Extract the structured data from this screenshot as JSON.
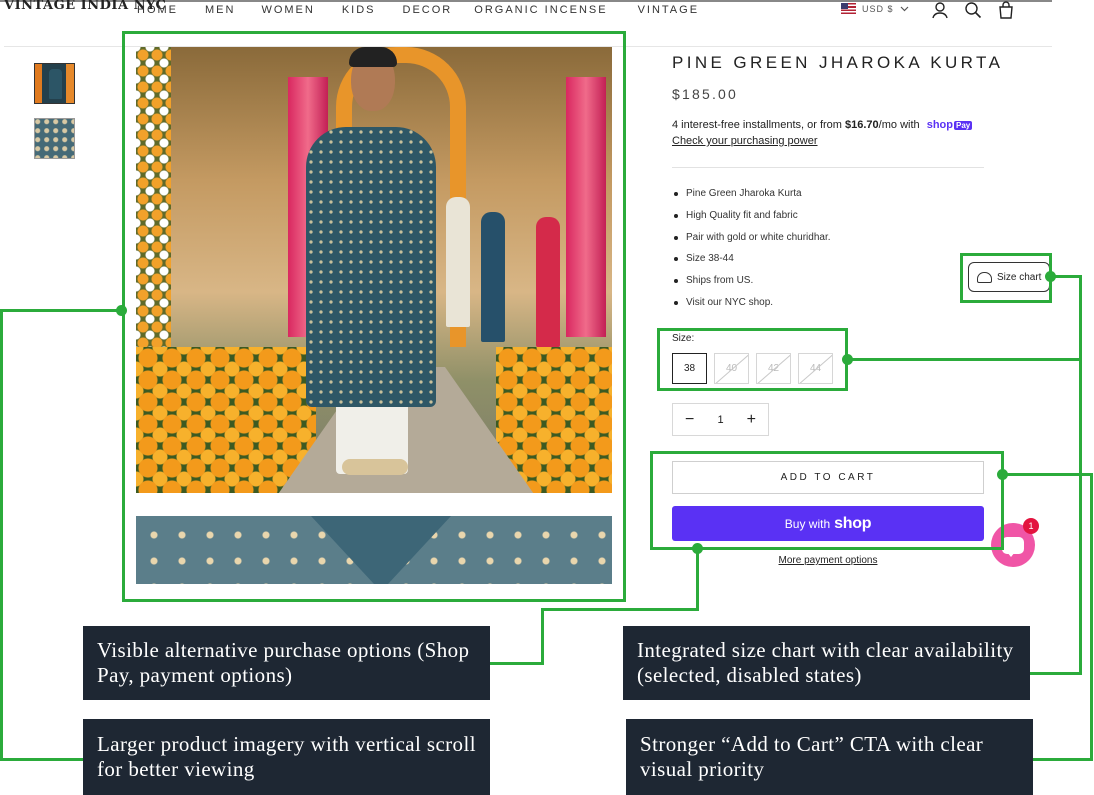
{
  "header": {
    "logo_text": "VINTAGE INDIA NYC",
    "nav": [
      "HOME",
      "MEN",
      "WOMEN",
      "KIDS",
      "DECOR",
      "ORGANIC INCENSE",
      "VINTAGE"
    ],
    "currency": "USD $"
  },
  "product": {
    "title": "PINE GREEN JHAROKA KURTA",
    "price": "$185.00",
    "installments_text": "4 interest-free installments, or from ",
    "installments_amount": "$16.70",
    "installments_suffix": "/mo with",
    "shop_word": "shop",
    "pay_word": "Pay",
    "check_power": "Check your purchasing power",
    "bullets": [
      "Pine Green Jharoka Kurta",
      "High Quality fit and fabric",
      "Pair with gold or white churidhar.",
      "Size 38-44",
      "Ships from US.",
      "Visit our NYC shop."
    ],
    "size_chart_label": "Size chart",
    "size_label": "Size:",
    "sizes": [
      "38",
      "40",
      "42",
      "44"
    ],
    "selected_size": "38",
    "quantity": "1",
    "add_to_cart": "ADD TO CART",
    "buy_with": "Buy with",
    "shop_logo": "shop",
    "more_payment": "More payment options"
  },
  "chat": {
    "badge": "1"
  },
  "annotations": {
    "purchase_options": "Visible alternative purchase options (Shop Pay, payment options)",
    "size_chart": "Integrated size chart with clear availability (selected, disabled states)",
    "imagery": "Larger product imagery with vertical scroll for better viewing",
    "cta": "Stronger “Add to Cart” CTA with clear visual priority"
  },
  "colors": {
    "annotation_green": "#2bab3b",
    "shop_purple": "#5a31f4",
    "callout_bg": "#1e2733",
    "chat_pink": "#f055a6"
  }
}
